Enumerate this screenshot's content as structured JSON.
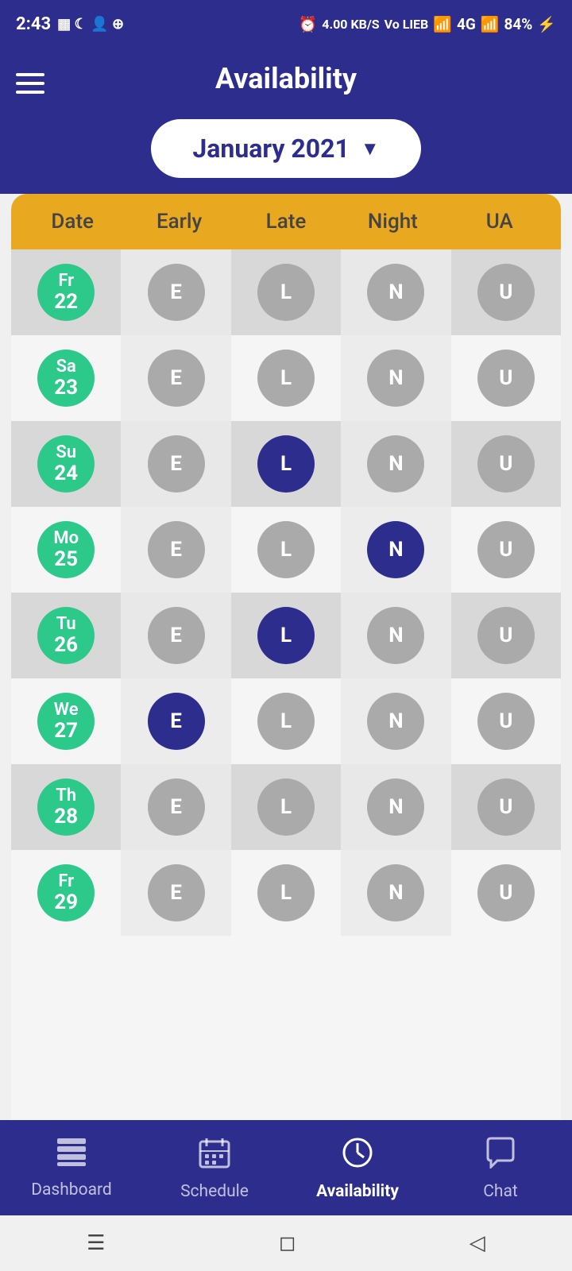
{
  "statusBar": {
    "time": "2:43",
    "battery": "84%",
    "signal": "4G"
  },
  "header": {
    "title": "Availability",
    "hamburgerLabel": "Menu"
  },
  "monthSelector": {
    "text": "January 2021",
    "arrowSymbol": "▼"
  },
  "tableHeader": {
    "columns": [
      "Date",
      "Early",
      "Late",
      "Night",
      "UA"
    ]
  },
  "rows": [
    {
      "date": {
        "abbr": "Fr",
        "num": "22"
      },
      "cells": [
        {
          "label": "E",
          "type": "gray"
        },
        {
          "label": "L",
          "type": "gray"
        },
        {
          "label": "N",
          "type": "gray"
        },
        {
          "label": "U",
          "type": "gray"
        }
      ]
    },
    {
      "date": {
        "abbr": "Sa",
        "num": "23"
      },
      "cells": [
        {
          "label": "E",
          "type": "gray"
        },
        {
          "label": "L",
          "type": "gray"
        },
        {
          "label": "N",
          "type": "gray"
        },
        {
          "label": "U",
          "type": "gray"
        }
      ]
    },
    {
      "date": {
        "abbr": "Su",
        "num": "24"
      },
      "cells": [
        {
          "label": "E",
          "type": "gray"
        },
        {
          "label": "L",
          "type": "navy"
        },
        {
          "label": "N",
          "type": "gray"
        },
        {
          "label": "U",
          "type": "gray"
        }
      ]
    },
    {
      "date": {
        "abbr": "Mo",
        "num": "25"
      },
      "cells": [
        {
          "label": "E",
          "type": "gray"
        },
        {
          "label": "L",
          "type": "gray"
        },
        {
          "label": "N",
          "type": "navy"
        },
        {
          "label": "U",
          "type": "gray"
        }
      ]
    },
    {
      "date": {
        "abbr": "Tu",
        "num": "26"
      },
      "cells": [
        {
          "label": "E",
          "type": "gray"
        },
        {
          "label": "L",
          "type": "navy"
        },
        {
          "label": "N",
          "type": "gray"
        },
        {
          "label": "U",
          "type": "gray"
        }
      ]
    },
    {
      "date": {
        "abbr": "We",
        "num": "27"
      },
      "cells": [
        {
          "label": "E",
          "type": "navy"
        },
        {
          "label": "L",
          "type": "gray"
        },
        {
          "label": "N",
          "type": "gray"
        },
        {
          "label": "U",
          "type": "gray"
        }
      ]
    },
    {
      "date": {
        "abbr": "Th",
        "num": "28"
      },
      "cells": [
        {
          "label": "E",
          "type": "gray"
        },
        {
          "label": "L",
          "type": "gray"
        },
        {
          "label": "N",
          "type": "gray"
        },
        {
          "label": "U",
          "type": "gray"
        }
      ]
    },
    {
      "date": {
        "abbr": "Fr",
        "num": "29"
      },
      "cells": [
        {
          "label": "E",
          "type": "gray"
        },
        {
          "label": "L",
          "type": "gray"
        },
        {
          "label": "N",
          "type": "gray"
        },
        {
          "label": "U",
          "type": "gray"
        }
      ]
    }
  ],
  "bottomNav": {
    "items": [
      {
        "label": "Dashboard",
        "icon": "layers",
        "active": false
      },
      {
        "label": "Schedule",
        "icon": "schedule",
        "active": false
      },
      {
        "label": "Availability",
        "icon": "clock",
        "active": true
      },
      {
        "label": "Chat",
        "icon": "chat",
        "active": false
      }
    ]
  }
}
